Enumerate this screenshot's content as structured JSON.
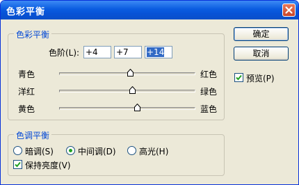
{
  "window": {
    "title": "色彩平衡"
  },
  "color_balance": {
    "legend": "色彩平衡",
    "levels_label": "色阶(L):",
    "levels": [
      "+4",
      "+7",
      "+14"
    ],
    "sliders": [
      {
        "left": "青色",
        "right": "红色",
        "value": 4
      },
      {
        "left": "洋红",
        "right": "绿色",
        "value": 7
      },
      {
        "left": "黄色",
        "right": "蓝色",
        "value": 14
      }
    ]
  },
  "tone_balance": {
    "legend": "色调平衡",
    "options": [
      {
        "label": "暗调(S)",
        "selected": false
      },
      {
        "label": "中间调(D)",
        "selected": true
      },
      {
        "label": "高光(H)",
        "selected": false
      }
    ],
    "preserve_luminosity": {
      "label": "保持亮度(V)",
      "checked": true
    }
  },
  "buttons": {
    "ok": "确定",
    "cancel": "取消"
  },
  "preview": {
    "label": "预览(P)",
    "checked": true
  },
  "colors": {
    "titlebar": "#0a5ce0",
    "legend": "#0046d5",
    "face": "#ece9d8",
    "check": "#21a121"
  }
}
